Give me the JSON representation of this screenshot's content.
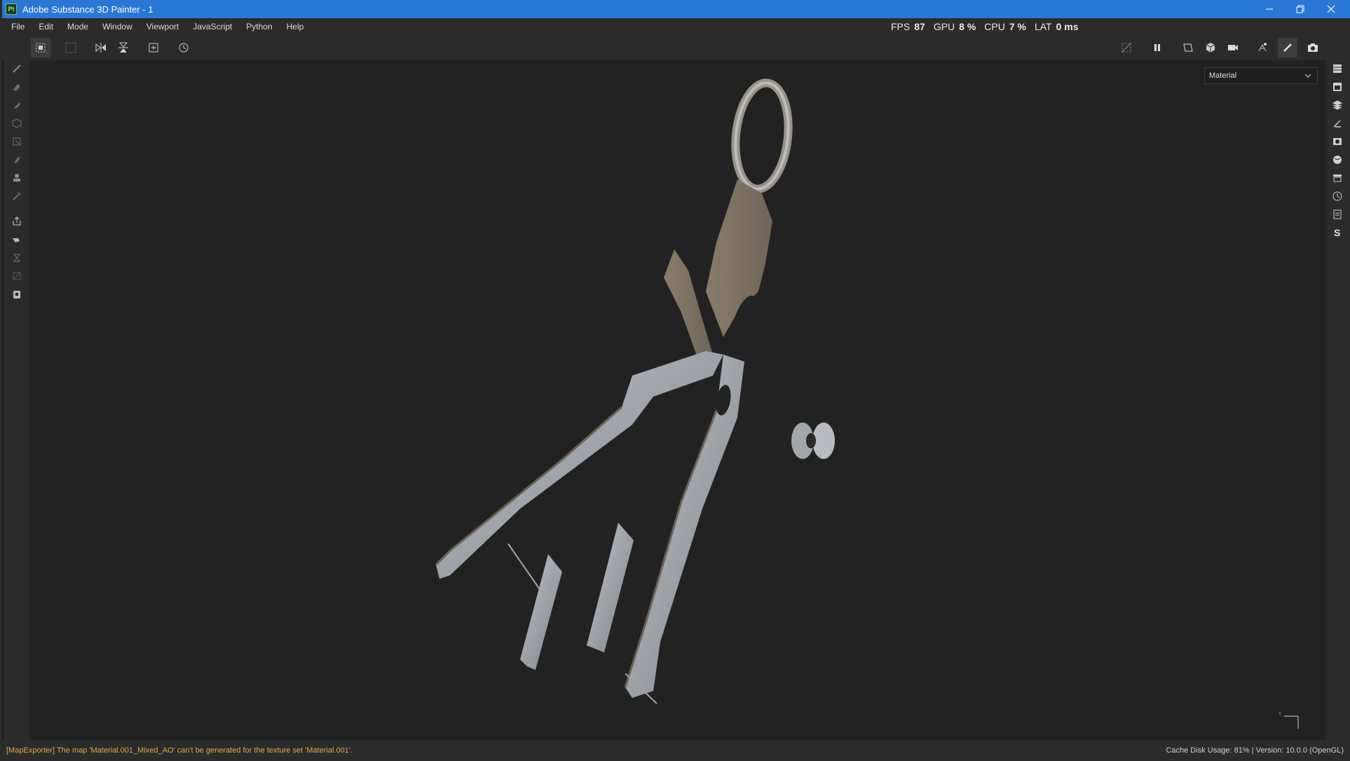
{
  "window": {
    "title": "Adobe Substance 3D Painter - 1",
    "logo_text": "Pt",
    "controls": [
      "minimize-icon",
      "restore-icon",
      "close-icon"
    ]
  },
  "menu": {
    "items": [
      "File",
      "Edit",
      "Mode",
      "Window",
      "Viewport",
      "JavaScript",
      "Python",
      "Help"
    ]
  },
  "performance": {
    "fps_label": "FPS",
    "fps_value": "87",
    "gpu_label": "GPU",
    "gpu_value": "8 %",
    "cpu_label": "CPU",
    "cpu_value": "7 %",
    "lat_label": "LAT",
    "lat_value": "0 ms"
  },
  "toolbar": {
    "left_tools": [
      "selection-mode-icon",
      "grid-mode-icon",
      "symmetry-x-icon",
      "symmetry-y-icon",
      "add-icon",
      "reset-camera-icon"
    ],
    "right_tools": [
      "hide-icon",
      "pause-icon",
      "frame-icon",
      "cube-view-icon",
      "camera-icon",
      "iray-icon",
      "paint-brush-icon",
      "screenshot-icon"
    ]
  },
  "left_tools": [
    "paint-icon",
    "eraser-icon",
    "projection-icon",
    "geometry-fill-icon",
    "polygon-fill-icon",
    "smudge-icon",
    "clone-icon",
    "color-picker-icon",
    "bake-icon",
    "material-picker-icon",
    "quick-mask-icon",
    "uv-icon",
    "stencil-icon"
  ],
  "right_tools": [
    "texture-sets-icon",
    "texture-set-settings-icon",
    "layers-icon",
    "properties-icon",
    "display-settings-icon",
    "environment-icon",
    "shelf-icon",
    "history-icon",
    "log-icon",
    "substance-icon"
  ],
  "viewport": {
    "display_mode": "Material"
  },
  "status": {
    "message": "[MapExporter] The map 'Material.001_Mixed_AO' can't be generated for the texture set 'Material.001'.",
    "right": "Cache Disk Usage:   81% | Version: 10.0.0 (OpenGL)"
  },
  "colors": {
    "titlebar": "#2a78d6",
    "panel": "#2b2b2b",
    "viewport": "#222222",
    "warning": "#e0a94a",
    "metal": "#a9adb4"
  }
}
